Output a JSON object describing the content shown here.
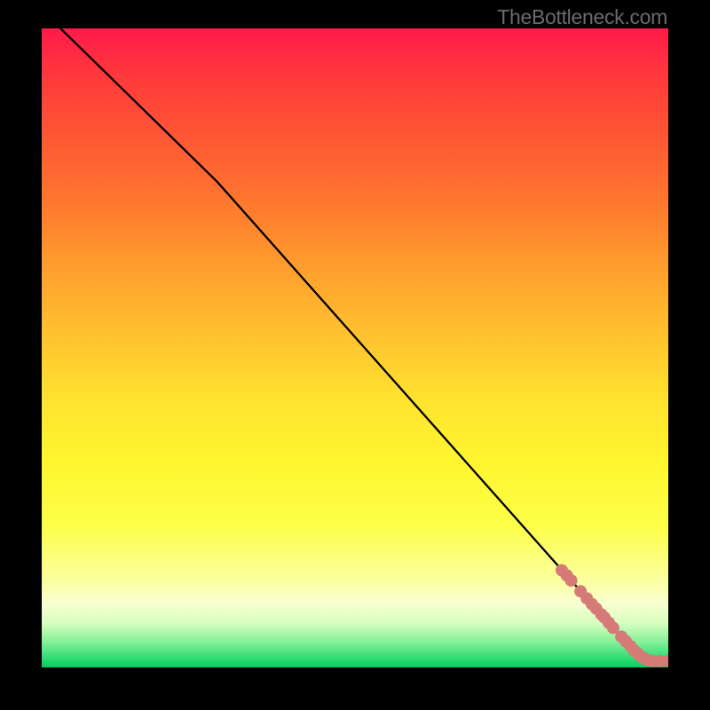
{
  "attribution": "TheBottleneck.com",
  "chart_data": {
    "type": "line",
    "title": "",
    "xlabel": "",
    "ylabel": "",
    "xlim": [
      0,
      100
    ],
    "ylim": [
      0,
      100
    ],
    "grid": false,
    "legend": false,
    "series": [
      {
        "name": "curve",
        "style": "line",
        "color": "#000000",
        "x": [
          3,
          28,
          95,
          100
        ],
        "y": [
          100,
          76,
          2,
          1
        ]
      },
      {
        "name": "markers",
        "style": "scatter",
        "color": "#d67a78",
        "points": [
          [
            83,
            15.2
          ],
          [
            83.8,
            14.4
          ],
          [
            84.5,
            13.6
          ],
          [
            86,
            11.9
          ],
          [
            87,
            10.8
          ],
          [
            87.8,
            9.9
          ],
          [
            88.5,
            9.2
          ],
          [
            89.3,
            8.3
          ],
          [
            89.8,
            7.8
          ],
          [
            90.5,
            7.0
          ],
          [
            91.2,
            6.2
          ],
          [
            92.5,
            4.8
          ],
          [
            93.2,
            4.1
          ],
          [
            94,
            3.3
          ],
          [
            94.6,
            2.6
          ],
          [
            95.2,
            2.1
          ],
          [
            95.8,
            1.6
          ],
          [
            96.6,
            1.2
          ],
          [
            97.5,
            1.0
          ],
          [
            98.6,
            1.0
          ],
          [
            100,
            1.0
          ]
        ]
      }
    ]
  }
}
